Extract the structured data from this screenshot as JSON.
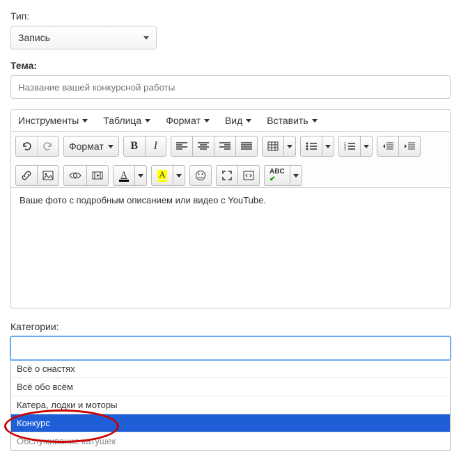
{
  "type_field": {
    "label": "Тип:",
    "value": "Запись"
  },
  "subject_field": {
    "label": "Тема:",
    "placeholder": "Название вашей конкурсной работы"
  },
  "menubar": {
    "tools": "Инструменты",
    "table": "Таблица",
    "format": "Формат",
    "view": "Вид",
    "insert": "Вставить"
  },
  "toolbar": {
    "format_btn": "Формат"
  },
  "editor": {
    "placeholder": "Ваше фото с подробным описанием или видео с YouTube."
  },
  "categories": {
    "label": "Категории:",
    "options": {
      "opt0": "Всё о снастях",
      "opt1": "Всё обо всём",
      "opt2": "Катера, лодки и моторы",
      "opt3": "Конкурс",
      "opt4": "Обслуживание катушек"
    },
    "selected_index": 3
  }
}
